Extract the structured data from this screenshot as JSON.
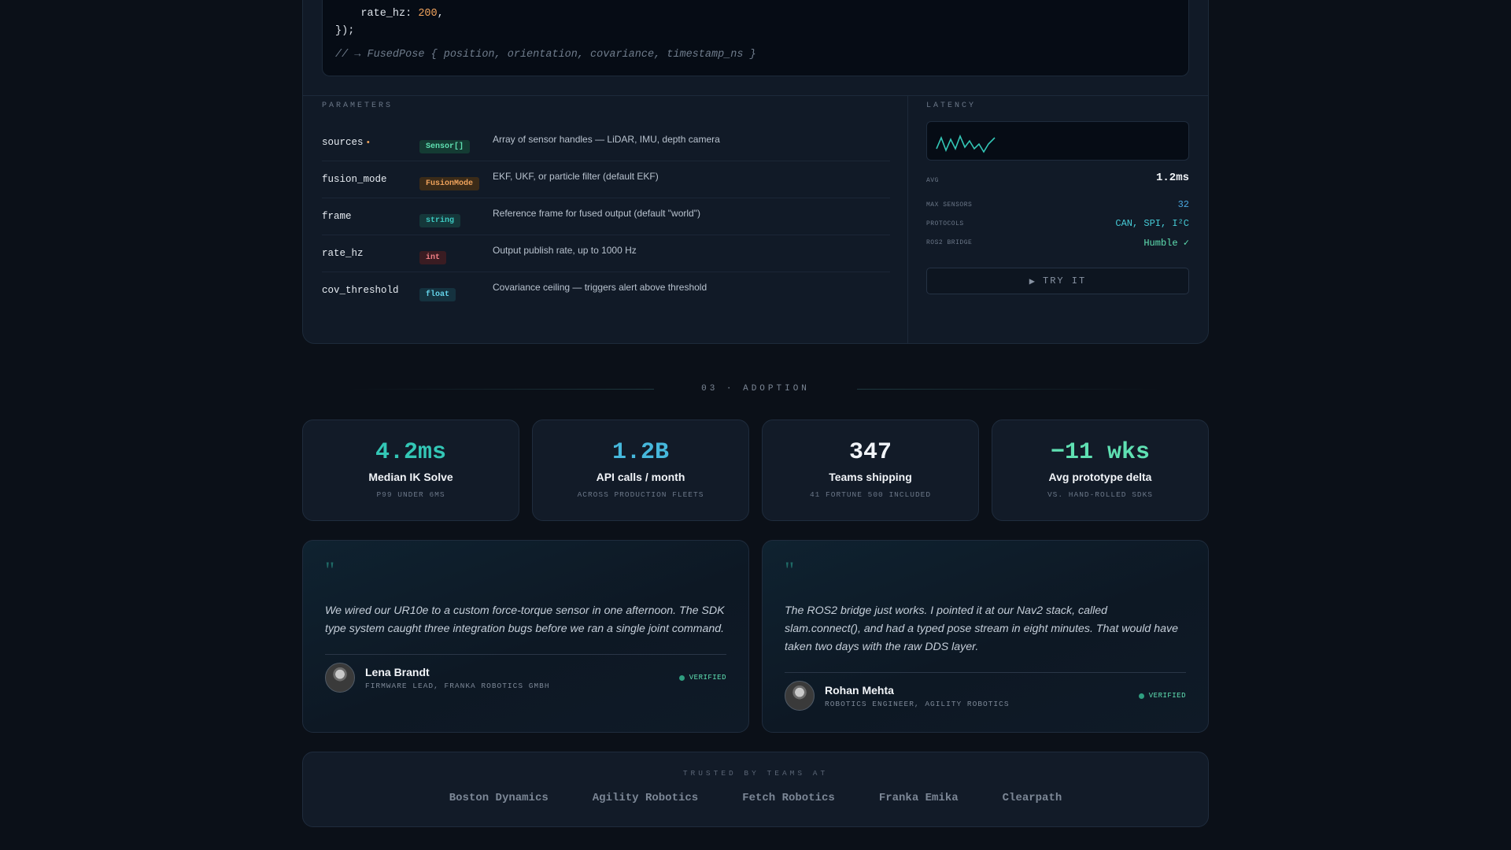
{
  "api": {
    "code": {
      "line1_key": "    rate_hz: ",
      "line1_value": "200",
      "line1_end": ",",
      "line2": "});",
      "comment": "// → FusedPose { position, orientation, covariance, timestamp_ns }"
    },
    "parameters_heading": "PARAMETERS",
    "parameters": [
      {
        "name": "sources",
        "required_mark": "•",
        "type": "Sensor[]",
        "desc": "Array of sensor handles — LiDAR, IMU, depth camera"
      },
      {
        "name": "fusion_mode",
        "required_mark": "",
        "type": "FusionMode",
        "desc": "EKF, UKF, or particle filter (default EKF)"
      },
      {
        "name": "frame",
        "required_mark": "",
        "type": "string",
        "desc": "Reference frame for fused output (default \"world\")"
      },
      {
        "name": "rate_hz",
        "required_mark": "",
        "type": "int",
        "desc": "Output publish rate, up to 1000 Hz"
      },
      {
        "name": "cov_threshold",
        "required_mark": "",
        "type": "float",
        "desc": "Covariance ceiling — triggers alert above threshold"
      }
    ],
    "latency": {
      "heading": "LATENCY",
      "avg_label": "AVG",
      "avg_value": "1.2ms",
      "specs": [
        {
          "label": "MAX SENSORS",
          "value": "32"
        },
        {
          "label": "PROTOCOLS",
          "value": "CAN, SPI, I²C"
        },
        {
          "label": "ROS2 BRIDGE",
          "value": "Humble ✓"
        }
      ],
      "try_icon": "▶",
      "try_label": "TRY IT"
    }
  },
  "adoption": {
    "heading": "03 · ADOPTION",
    "metrics": [
      {
        "value": "4.2ms",
        "label": "Median IK Solve",
        "sub": "P99 UNDER 6MS",
        "color": "#33c7b6"
      },
      {
        "value": "1.2B",
        "label": "API calls / month",
        "sub": "ACROSS PRODUCTION FLEETS",
        "color": "#46b8dc"
      },
      {
        "value": "347",
        "label": "Teams shipping",
        "sub": "41 FORTUNE 500 INCLUDED",
        "color": "#f1f4f8"
      },
      {
        "value": "−11 wks",
        "label": "Avg prototype delta",
        "sub": "VS. HAND-ROLLED SDKS",
        "color": "#5fe0b2"
      }
    ],
    "testimonials": [
      {
        "quote_mark": "\"",
        "quote": "We wired our UR10e to a custom force-torque sensor in one afternoon. The SDK type system caught three integration bugs before we ran a single joint command.",
        "name": "Lena Brandt",
        "role": "FIRMWARE LEAD, FRANKA ROBOTICS GMBH",
        "badge": "VERIFIED"
      },
      {
        "quote_mark": "\"",
        "quote": "The ROS2 bridge just works. I pointed it at our Nav2 stack, called slam.connect(), and had a typed pose stream in eight minutes. That would have taken two days with the raw DDS layer.",
        "name": "Rohan Mehta",
        "role": "ROBOTICS ENGINEER, AGILITY ROBOTICS",
        "badge": "VERIFIED"
      }
    ],
    "trusted_heading": "TRUSTED BY TEAMS AT",
    "logos": [
      "Boston Dynamics",
      "Agility Robotics",
      "Fetch Robotics",
      "Franka Emika",
      "Clearpath"
    ]
  }
}
